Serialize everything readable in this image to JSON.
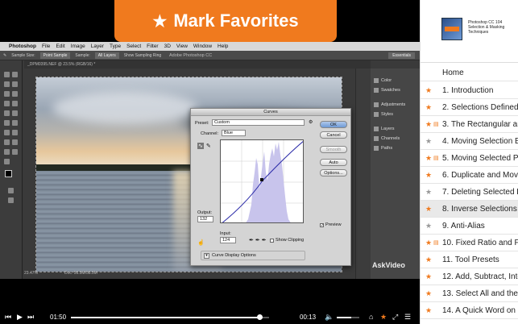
{
  "banner": {
    "icon": "star-icon",
    "label": "Mark Favorites"
  },
  "photoshop": {
    "menu": [
      "Photoshop",
      "File",
      "Edit",
      "Image",
      "Layer",
      "Type",
      "Select",
      "Filter",
      "3D",
      "View",
      "Window",
      "Help"
    ],
    "window_title": "Adobe Photoshop CC",
    "options": {
      "sample_size_label": "Sample Size:",
      "sample_size_value": "Point Sample",
      "sample_label": "Sample:",
      "sample_value": "All Layers",
      "show_ring": "Show Sampling Ring"
    },
    "workspace": "Essentials",
    "doc_tab": "_DPM0395.NEF @ 23.5% (RGB/16) *",
    "status_zoom": "23.47%",
    "status_doc": "Doc: 58.5M/58.5M",
    "panels": [
      "Color",
      "Swatches",
      "Adjustments",
      "Styles",
      "Layers",
      "Channels",
      "Paths"
    ],
    "watermark": "AskVideo"
  },
  "curves": {
    "title": "Curves",
    "preset_label": "Preset:",
    "preset_value": "Custom",
    "channel_label": "Channel:",
    "channel_value": "Blue",
    "output_label": "Output:",
    "output_value": "132",
    "input_label": "Input:",
    "input_value": "124",
    "show_clipping": "Show Clipping",
    "display_options": "Curve Display Options",
    "buttons": {
      "ok": "OK",
      "cancel": "Cancel",
      "smooth": "Smooth",
      "auto": "Auto",
      "options": "Options..."
    },
    "preview_label": "Preview",
    "preview_checked": true
  },
  "player": {
    "elapsed": "01:50",
    "remaining": "00:13",
    "progress_fraction": 0.95,
    "volume_fraction": 0.65
  },
  "sidebar": {
    "course_title": "Photoshop CC 104",
    "course_subtitle": "Selection & Masking Techniques",
    "home": "Home",
    "items": [
      {
        "label": "1. Introduction",
        "star": "orange",
        "doc": false
      },
      {
        "label": "2. Selections Defined",
        "star": "orange",
        "doc": false
      },
      {
        "label": "3. The Rectangular and",
        "star": "orange",
        "doc": true
      },
      {
        "label": "4. Moving Selection Bo",
        "star": "gray",
        "doc": false
      },
      {
        "label": "5. Moving Selected Pix",
        "star": "orange",
        "doc": true
      },
      {
        "label": "6. Duplicate and Move",
        "star": "orange",
        "doc": false
      },
      {
        "label": "7. Deleting Selected Pi",
        "star": "gray",
        "doc": false
      },
      {
        "label": "8. Inverse Selections",
        "star": "orange",
        "doc": false,
        "active": true
      },
      {
        "label": "9. Anti-Alias",
        "star": "gray",
        "doc": false
      },
      {
        "label": "10. Fixed Ratio and Fix",
        "star": "orange",
        "doc": true
      },
      {
        "label": "11. Tool Presets",
        "star": "orange",
        "doc": false
      },
      {
        "label": "12. Add, Subtract, Inte",
        "star": "orange",
        "doc": false
      },
      {
        "label": "13. Select All and the S",
        "star": "orange",
        "doc": false
      },
      {
        "label": "14. A Quick Word on F",
        "star": "orange",
        "doc": false
      }
    ]
  },
  "colors": {
    "accent": "#f07a1e",
    "histogram": "#c8c4ec",
    "curve": "#2a2aa8"
  }
}
